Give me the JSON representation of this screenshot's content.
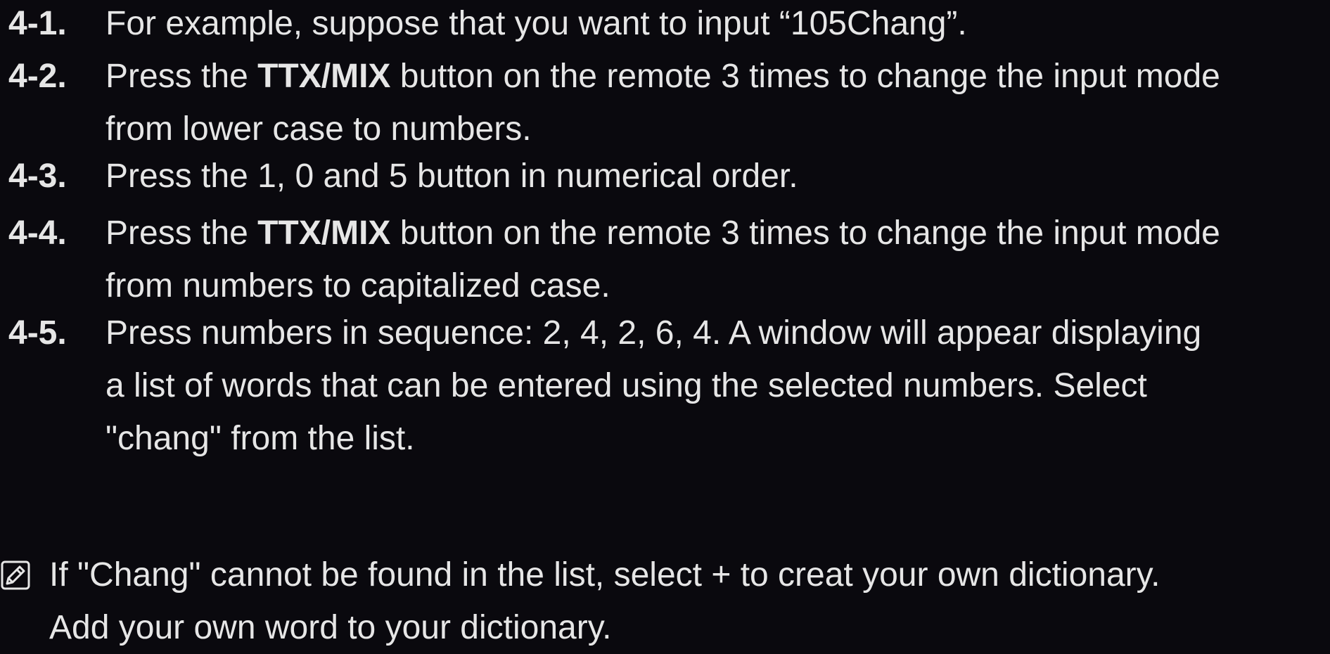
{
  "steps": [
    {
      "num": "4-1.",
      "lines": [
        {
          "pre": "For example, suppose that you want to input “105Chang”.",
          "bold": "",
          "post": ""
        }
      ]
    },
    {
      "num": "4-2.",
      "lines": [
        {
          "pre": "Press the ",
          "bold": "TTX/MIX",
          "post": " button on the remote 3 times to change the input mode"
        },
        {
          "pre": "from lower case to numbers.",
          "bold": "",
          "post": ""
        }
      ]
    },
    {
      "num": "4-3.",
      "lines": [
        {
          "pre": "Press the 1, 0 and 5 button in numerical order.",
          "bold": "",
          "post": ""
        }
      ]
    },
    {
      "num": "4-4.",
      "lines": [
        {
          "pre": "Press the ",
          "bold": "TTX/MIX",
          "post": " button on the remote 3 times to change the input mode"
        },
        {
          "pre": "from numbers to capitalized case.",
          "bold": "",
          "post": ""
        }
      ]
    },
    {
      "num": "4-5.",
      "lines": [
        {
          "pre": "Press numbers in sequence: 2, 4, 2, 6, 4. A window will appear displaying",
          "bold": "",
          "post": ""
        },
        {
          "pre": "a list of words that can be entered using the selected numbers. Select",
          "bold": "",
          "post": ""
        },
        {
          "pre": "\"chang\" from the list.",
          "bold": "",
          "post": ""
        }
      ]
    }
  ],
  "note": {
    "icon": "note-icon",
    "lines": [
      "If \"Chang\" cannot be found in the list, select + to creat your own dictionary.",
      "Add your own word to your dictionary."
    ]
  },
  "colors": {
    "background": "#0a090e",
    "text": "#e6e6e6"
  }
}
